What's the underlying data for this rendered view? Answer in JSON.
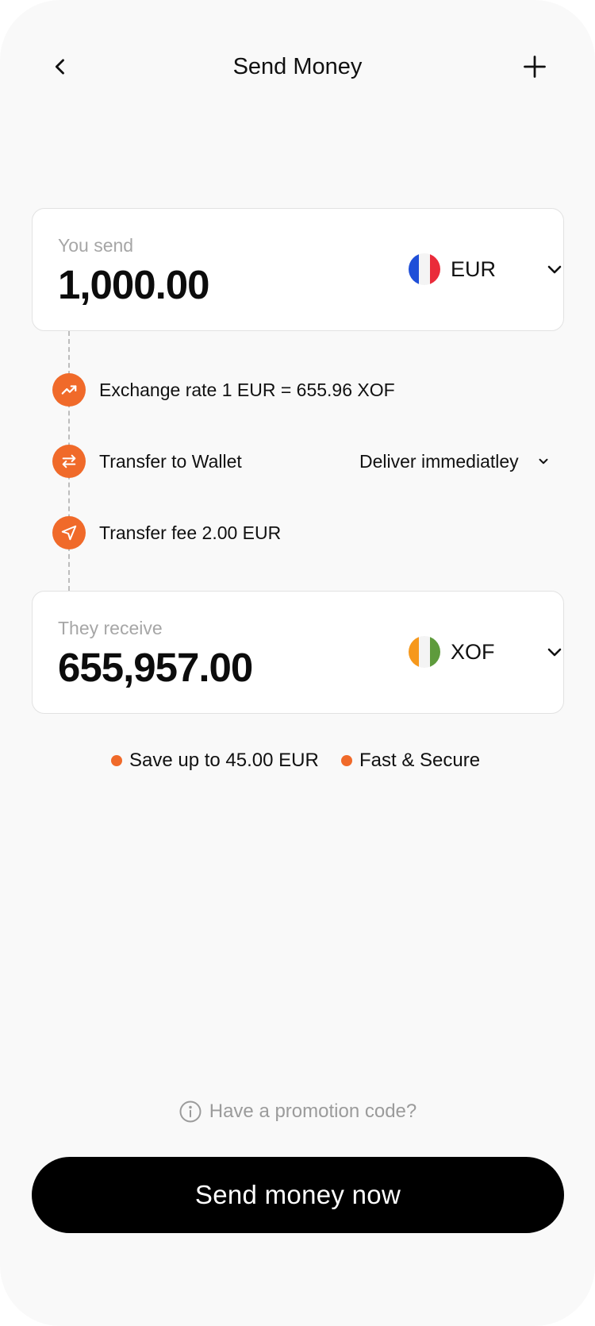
{
  "header": {
    "title": "Send Money",
    "back_icon": "chevron-left-icon",
    "add_icon": "plus-icon"
  },
  "send": {
    "label": "You send",
    "amount": "1,000.00",
    "currency": "EUR",
    "flag": "france-flag",
    "flag_colors": [
      "#1f4fd8",
      "#f4f4f4",
      "#ea2b3a"
    ]
  },
  "details": {
    "exchange_rate": "Exchange rate 1 EUR = 655.96 XOF",
    "exchange_icon": "trending-up-icon",
    "transfer_method": "Transfer to Wallet",
    "transfer_icon": "swap-arrows-icon",
    "delivery": "Deliver immediatley",
    "fee": "Transfer fee 2.00 EUR",
    "fee_icon": "send-arrow-icon"
  },
  "receive": {
    "label": "They receive",
    "amount": "655,957.00",
    "currency": "XOF",
    "flag": "ivory-coast-flag",
    "flag_colors": [
      "#f6981c",
      "#f4f4f4",
      "#5e9b3c"
    ]
  },
  "features": [
    {
      "label": "Save up to 45.00 EUR"
    },
    {
      "label": "Fast & Secure"
    }
  ],
  "promo": {
    "text": "Have a promotion code?",
    "icon": "info-icon"
  },
  "cta": {
    "label": "Send money now"
  },
  "colors": {
    "accent": "#f06a2a",
    "primary_button": "#000000",
    "background": "#f9f9f9"
  }
}
